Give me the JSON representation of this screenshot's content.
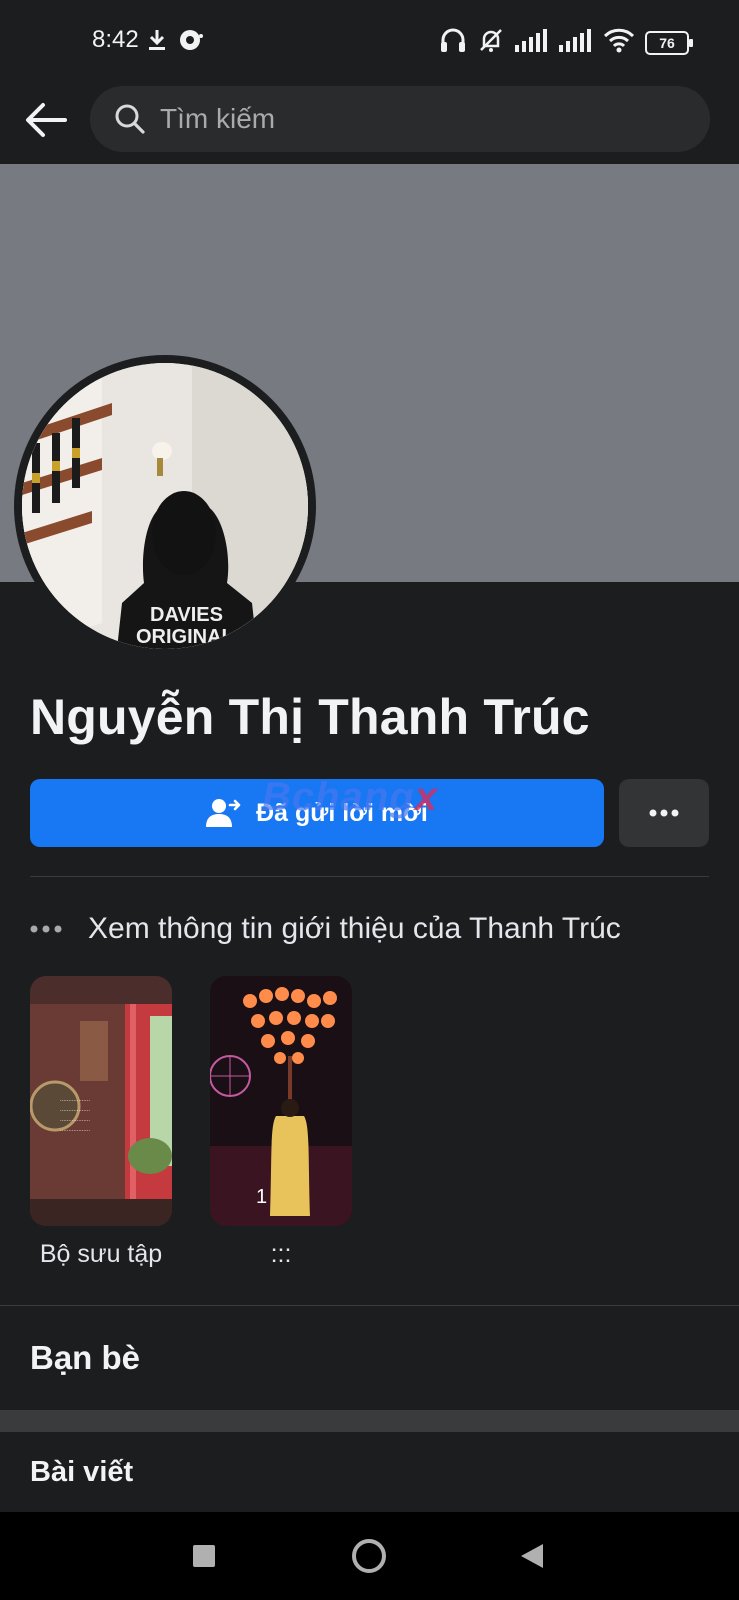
{
  "status_bar": {
    "time": "8:42",
    "battery": "76",
    "icons_left": [
      "download-icon",
      "messenger-bubble-icon"
    ],
    "icons_right": [
      "headset-icon",
      "bell-muted-icon",
      "signal-icon",
      "signal-icon",
      "wifi-icon",
      "battery-icon"
    ]
  },
  "search": {
    "placeholder": "Tìm kiếm"
  },
  "profile": {
    "name": "Nguyễn Thị Thanh Trúc",
    "cover_color": "#777a80"
  },
  "actions": {
    "request_label": "Đã gửi lời mời",
    "accent": "#1877f2",
    "watermark": "Bchang",
    "watermark_suffix": "x"
  },
  "intro": {
    "label": "Xem thông tin giới thiệu của Thanh Trúc"
  },
  "featured": [
    {
      "label": "Bộ sưu tập",
      "count": ""
    },
    {
      "label": ":::",
      "count": "1"
    }
  ],
  "sections": {
    "friends": "Bạn bè",
    "posts": "Bài viết"
  }
}
